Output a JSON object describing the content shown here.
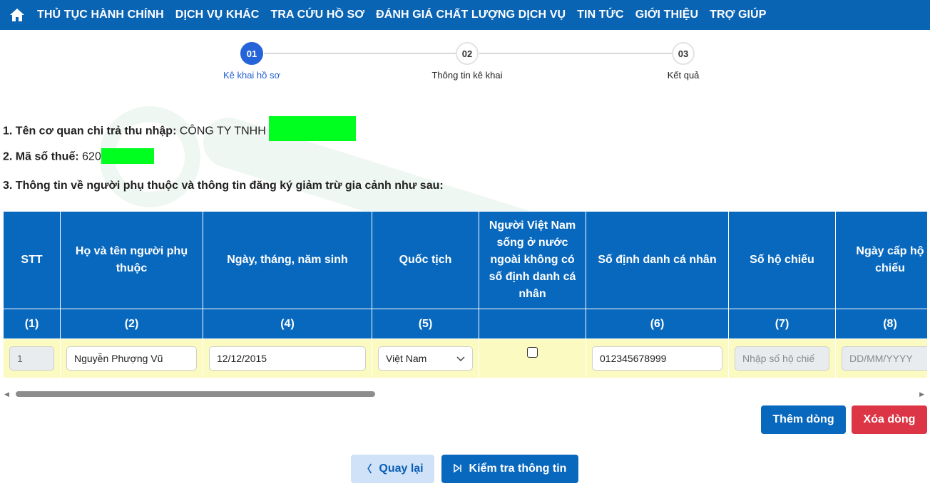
{
  "nav": {
    "items": [
      "THỦ TỤC HÀNH CHÍNH",
      "DỊCH VỤ KHÁC",
      "TRA CỨU HỒ SƠ",
      "ĐÁNH GIÁ CHẤT LƯỢNG DỊCH VỤ",
      "TIN TỨC",
      "GIỚI THIỆU",
      "TRỢ GIÚP"
    ]
  },
  "stepper": {
    "steps": [
      {
        "number": "01",
        "label": "Kê khai hồ sơ",
        "active": true
      },
      {
        "number": "02",
        "label": "Thông tin kê khai",
        "active": false
      },
      {
        "number": "03",
        "label": "Kết quả",
        "active": false
      }
    ]
  },
  "info": {
    "line1_label": "1. Tên cơ quan chi trả thu nhập:",
    "line1_value": "CÔNG TY TNHH",
    "line2_label": "2. Mã số thuế:",
    "line2_value": "620",
    "line3_label": "3. Thông tin về người phụ thuộc và thông tin đăng ký giảm trừ gia cảnh như sau:"
  },
  "table": {
    "headers": [
      "STT",
      "Họ và tên người phụ thuộc",
      "Ngày, tháng, năm sinh",
      "Quốc tịch",
      "Người Việt Nam sống ở nước ngoài không có số định danh cá nhân",
      "Số định danh cá nhân",
      "Số hộ chiếu",
      "Ngày cấp hộ chiếu"
    ],
    "codes": [
      "(1)",
      "(2)",
      "(4)",
      "(5)",
      "",
      "(6)",
      "(7)",
      "(8)"
    ],
    "row": {
      "stt": "1",
      "name": "Nguyễn Phượng Vũ",
      "dob": "12/12/2015",
      "nationality": "Việt Nam",
      "id_number": "012345678999",
      "passport_placeholder": "Nhập số hộ chiế",
      "passport_date_placeholder": "DD/MM/YYYY"
    }
  },
  "buttons": {
    "add_row": "Thêm dòng",
    "delete_row": "Xóa dòng",
    "back": "Quay lại",
    "check": "Kiểm tra thông tin"
  },
  "colors": {
    "nav": "#0a64b4",
    "header": "#0868be",
    "row_bg": "#fbfac1",
    "active_step": "#2563d9",
    "delete": "#dc3545",
    "redaction": "#00ff1e"
  }
}
